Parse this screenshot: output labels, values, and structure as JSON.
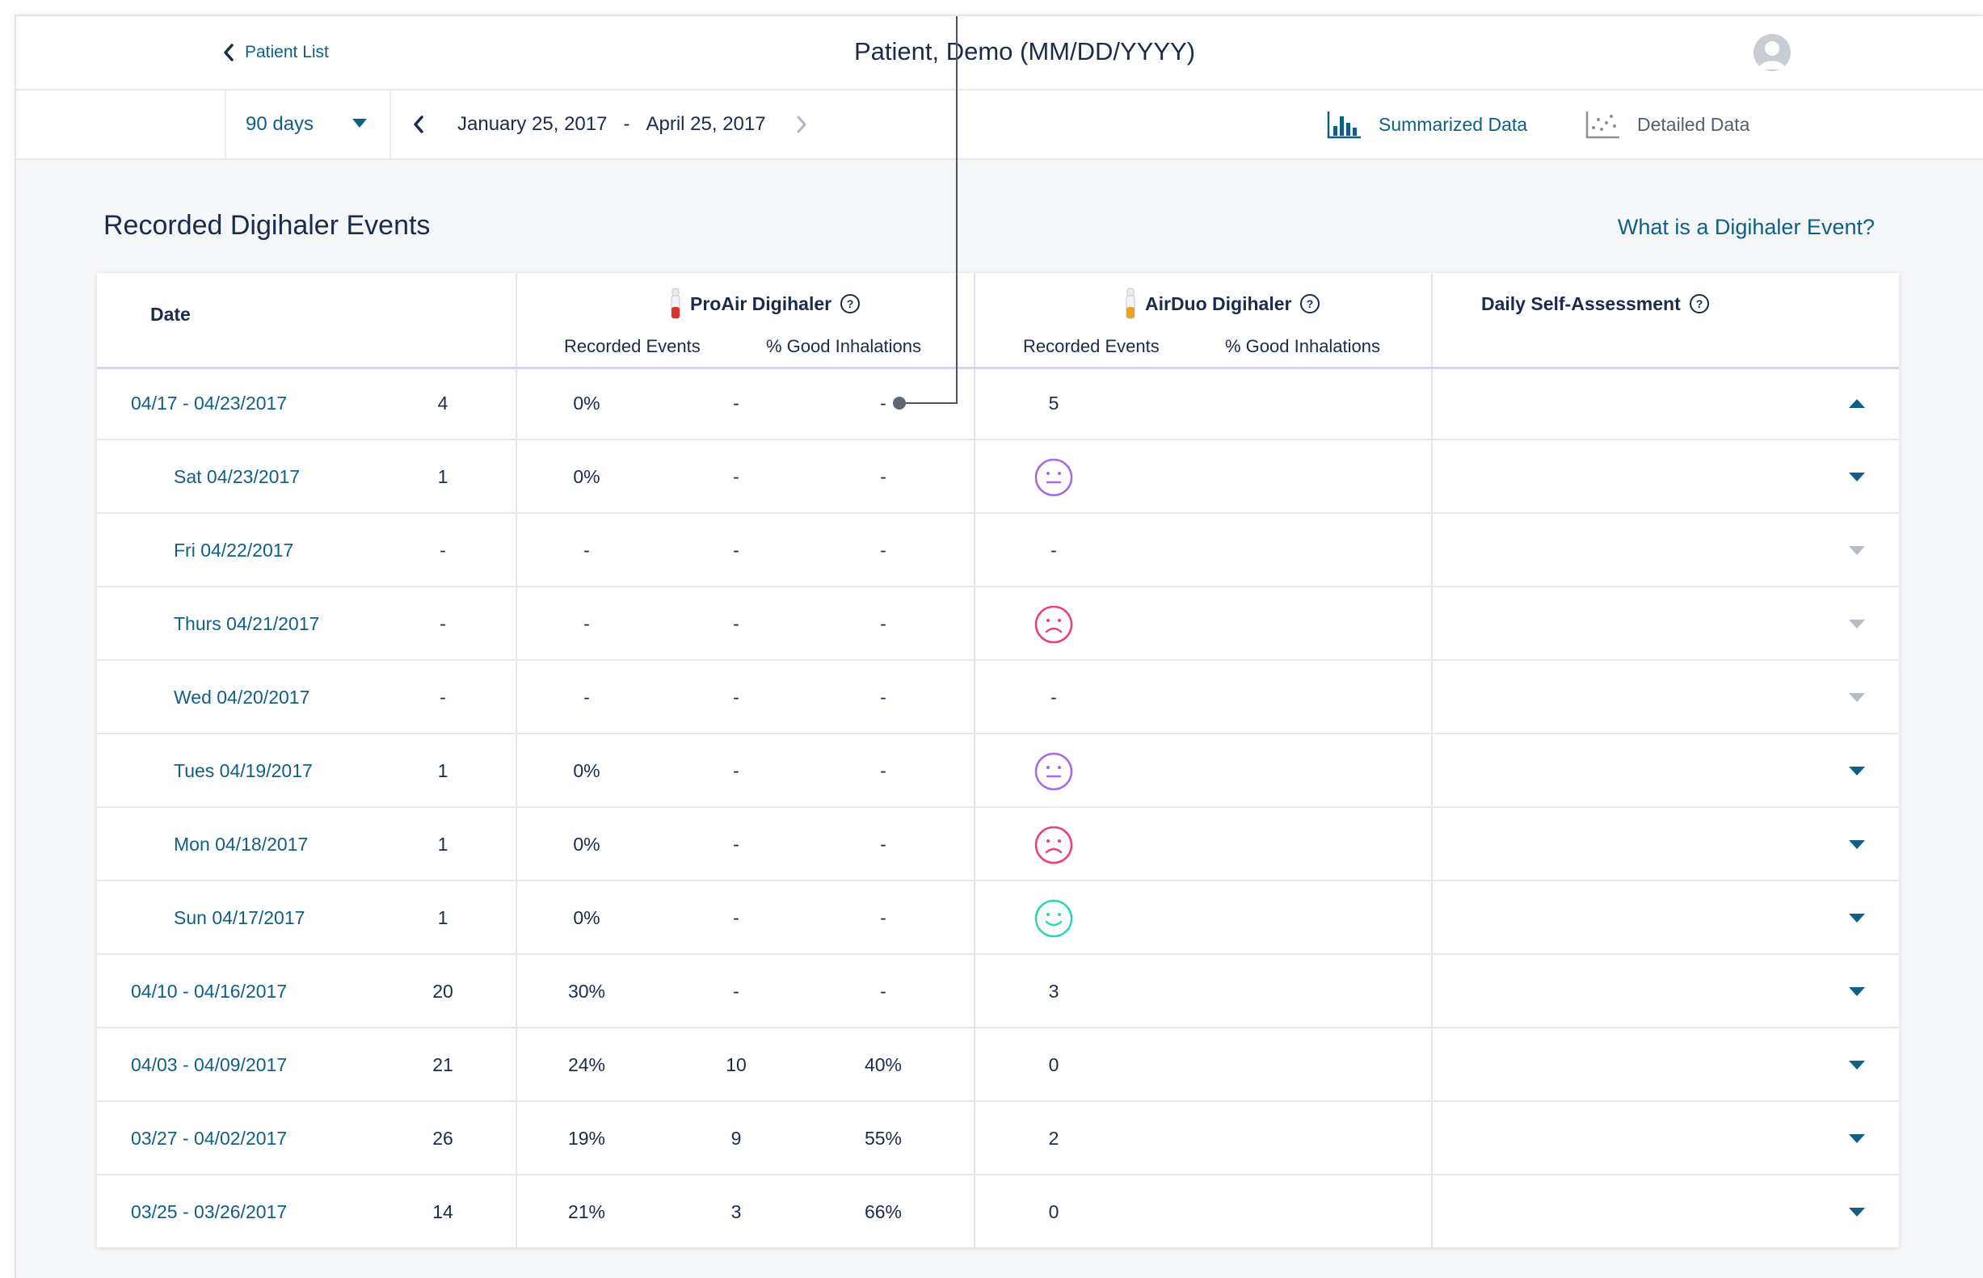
{
  "header": {
    "back_label": "Patient List",
    "patient_name": "Patient, Demo (MM/DD/YYYY)"
  },
  "toolbar": {
    "range": "90 days",
    "start_date": "January 25, 2017",
    "separator": "-",
    "end_date": "April 25, 2017",
    "summarized_label": "Summarized Data",
    "detailed_label": "Detailed Data"
  },
  "section": {
    "title": "Recorded Digihaler Events",
    "help_link": "What is a Digihaler Event?"
  },
  "table": {
    "headers": {
      "date": "Date",
      "proair": "ProAir Digihaler",
      "airduo": "AirDuo Digihaler",
      "self_assessment": "Daily Self-Assessment",
      "recorded_events": "Recorded Events",
      "good_inhalations": "% Good Inhalations"
    },
    "colors": {
      "proair_icon": "#d9342b",
      "airduo_icon": "#e9a22a",
      "neutral_face": "#a46be8",
      "sad_face": "#ee3f73",
      "happy_face": "#2fd6b0"
    },
    "rows": [
      {
        "date": "04/17 - 04/23/2017",
        "level": "week",
        "pa_events": "4",
        "pa_good": "0%",
        "ad_events": "-",
        "ad_good": "-",
        "assessment": "5",
        "face": "",
        "expand": "up"
      },
      {
        "date": "Sat 04/23/2017",
        "level": "day",
        "pa_events": "1",
        "pa_good": "0%",
        "ad_events": "-",
        "ad_good": "-",
        "assessment": "",
        "face": "neutral",
        "expand": "down"
      },
      {
        "date": "Fri 04/22/2017",
        "level": "day",
        "pa_events": "-",
        "pa_good": "-",
        "ad_events": "-",
        "ad_good": "-",
        "assessment": "-",
        "face": "",
        "expand": "muted"
      },
      {
        "date": "Thurs 04/21/2017",
        "level": "day",
        "pa_events": "-",
        "pa_good": "-",
        "ad_events": "-",
        "ad_good": "-",
        "assessment": "",
        "face": "sad",
        "expand": "muted"
      },
      {
        "date": "Wed 04/20/2017",
        "level": "day",
        "pa_events": "-",
        "pa_good": "-",
        "ad_events": "-",
        "ad_good": "-",
        "assessment": "-",
        "face": "",
        "expand": "muted"
      },
      {
        "date": "Tues 04/19/2017",
        "level": "day",
        "pa_events": "1",
        "pa_good": "0%",
        "ad_events": "-",
        "ad_good": "-",
        "assessment": "",
        "face": "neutral",
        "expand": "down"
      },
      {
        "date": "Mon 04/18/2017",
        "level": "day",
        "pa_events": "1",
        "pa_good": "0%",
        "ad_events": "-",
        "ad_good": "-",
        "assessment": "",
        "face": "sad",
        "expand": "down"
      },
      {
        "date": "Sun 04/17/2017",
        "level": "day",
        "pa_events": "1",
        "pa_good": "0%",
        "ad_events": "-",
        "ad_good": "-",
        "assessment": "",
        "face": "happy",
        "expand": "down"
      },
      {
        "date": "04/10 - 04/16/2017",
        "level": "week",
        "pa_events": "20",
        "pa_good": "30%",
        "ad_events": "-",
        "ad_good": "-",
        "assessment": "3",
        "face": "",
        "expand": "down"
      },
      {
        "date": "04/03 - 04/09/2017",
        "level": "week",
        "pa_events": "21",
        "pa_good": "24%",
        "ad_events": "10",
        "ad_good": "40%",
        "assessment": "0",
        "face": "",
        "expand": "down"
      },
      {
        "date": "03/27 - 04/02/2017",
        "level": "week",
        "pa_events": "26",
        "pa_good": "19%",
        "ad_events": "9",
        "ad_good": "55%",
        "assessment": "2",
        "face": "",
        "expand": "down"
      },
      {
        "date": "03/25 - 03/26/2017",
        "level": "week",
        "pa_events": "14",
        "pa_good": "21%",
        "ad_events": "3",
        "ad_good": "66%",
        "assessment": "0",
        "face": "",
        "expand": "down"
      }
    ]
  }
}
